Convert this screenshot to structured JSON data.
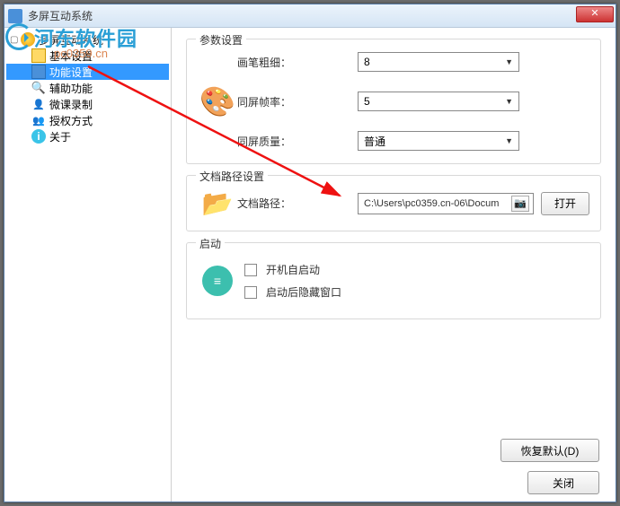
{
  "window": {
    "title": "多屏互动系统"
  },
  "tree": {
    "root": "多屏互动系统",
    "items": [
      "基本设置",
      "功能设置",
      "辅助功能",
      "微课录制",
      "授权方式",
      "关于"
    ]
  },
  "groups": {
    "params": {
      "title": "参数设置",
      "pen_label": "画笔粗细：",
      "pen_value": "8",
      "fps_label": "同屏帧率：",
      "fps_value": "5",
      "quality_label": "同屏质量：",
      "quality_value": "普通"
    },
    "path": {
      "title": "文档路径设置",
      "label": "文档路径：",
      "value": "C:\\Users\\pc0359.cn-06\\Docum",
      "open": "打开"
    },
    "startup": {
      "title": "启动",
      "auto_start": "开机自启动",
      "hide_window": "启动后隐藏窗口"
    }
  },
  "buttons": {
    "restore": "恢复默认(D)",
    "close": "关闭"
  },
  "watermark": {
    "text": "河东软件园",
    "sub": "pc0359.cn"
  }
}
